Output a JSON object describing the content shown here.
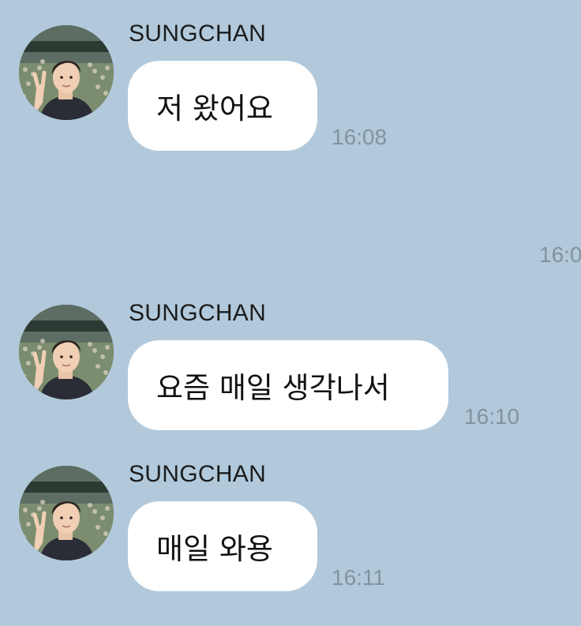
{
  "colors": {
    "background": "#b1c9db",
    "bubble": "#ffffff",
    "timestamp": "#8293a0",
    "name": "#1c1c1c"
  },
  "messages": [
    {
      "sender": "SUNGCHAN",
      "text": "저 왔어요",
      "time": "16:08",
      "avatar_icon": "profile-photo"
    },
    {
      "sender": "SUNGCHAN",
      "text": "요즘 매일 생각나서",
      "time": "16:10",
      "avatar_icon": "profile-photo"
    },
    {
      "sender": "SUNGCHAN",
      "text": "매일 와용",
      "time": "16:11",
      "avatar_icon": "profile-photo"
    }
  ],
  "partial_timestamp": "16:0"
}
